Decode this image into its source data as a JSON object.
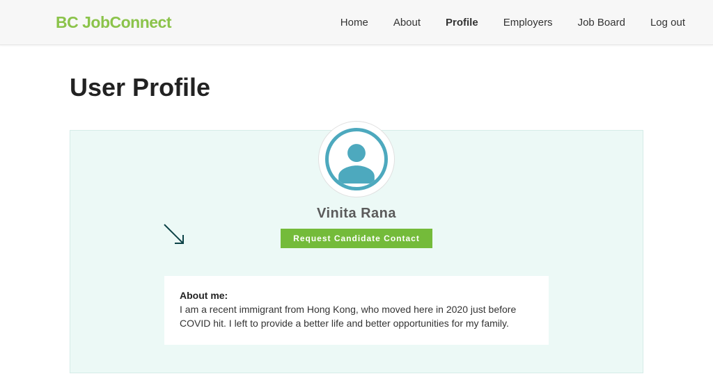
{
  "header": {
    "logo": "BC JobConnect",
    "nav": {
      "home": "Home",
      "about": "About",
      "profile": "Profile",
      "employers": "Employers",
      "jobboard": "Job Board",
      "logout": "Log out"
    }
  },
  "page": {
    "title": "User Profile"
  },
  "profile": {
    "name": "Vinita Rana",
    "request_button": "Request Candidate Contact",
    "about_label": "About me:",
    "about_text": "I am a recent immigrant from Hong Kong, who moved here in 2020 just before COVID hit. I left to provide a better life and better opportunities for my family."
  }
}
